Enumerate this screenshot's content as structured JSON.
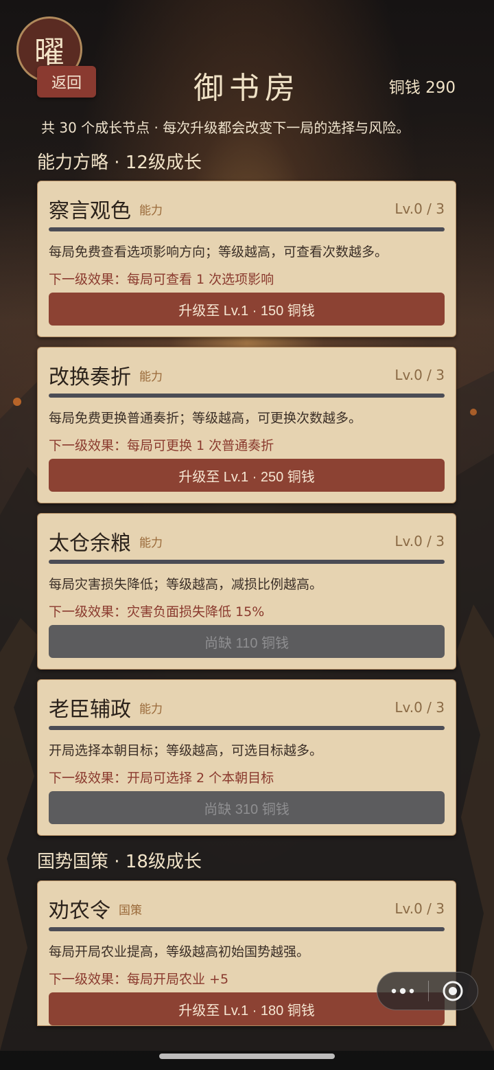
{
  "header": {
    "avatar_char": "曜",
    "back_label": "返回",
    "title": "御书房",
    "coins": "铜钱 290"
  },
  "subtitle": "共 30 个成长节点 · 每次升级都会改变下一局的选择与风险。",
  "sections": [
    {
      "title": "能力方略 · 12级成长",
      "cards": [
        {
          "name": "察言观色",
          "tag": "能力",
          "level": "Lv.0 / 3",
          "progress": 0,
          "desc": "每局免费查看选项影响方向；等级越高，可查看次数越多。",
          "next": "下一级效果：每局可查看 1 次选项影响",
          "action": "升级至 Lv.1 · 150 铜钱",
          "action_state": "buy"
        },
        {
          "name": "改换奏折",
          "tag": "能力",
          "level": "Lv.0 / 3",
          "progress": 0,
          "desc": "每局免费更换普通奏折；等级越高，可更换次数越多。",
          "next": "下一级效果：每局可更换 1 次普通奏折",
          "action": "升级至 Lv.1 · 250 铜钱",
          "action_state": "buy"
        },
        {
          "name": "太仓余粮",
          "tag": "能力",
          "level": "Lv.0 / 3",
          "progress": 0,
          "desc": "每局灾害损失降低；等级越高，减损比例越高。",
          "next": "下一级效果：灾害负面损失降低 15%",
          "action": "尚缺 110 铜钱",
          "action_state": "locked"
        },
        {
          "name": "老臣辅政",
          "tag": "能力",
          "level": "Lv.0 / 3",
          "progress": 0,
          "desc": "开局选择本朝目标；等级越高，可选目标越多。",
          "next": "下一级效果：开局可选择 2 个本朝目标",
          "action": "尚缺 310 铜钱",
          "action_state": "locked"
        }
      ]
    },
    {
      "title": "国势国策 · 18级成长",
      "cards": [
        {
          "name": "劝农令",
          "tag": "国策",
          "level": "Lv.0 / 3",
          "progress": 0,
          "desc": "每局开局农业提高，等级越高初始国势越强。",
          "next": "下一级效果：每局开局农业 +5",
          "action": "升级至 Lv.1 · 180 铜钱",
          "action_state": "buy"
        }
      ]
    }
  ],
  "colors": {
    "card_bg": "#e6d3b1",
    "buy_button": "#8c4233",
    "locked_button": "#5c5c5e",
    "accent_red": "#8a3a2e"
  },
  "icons": {
    "more": "more-dots-icon",
    "close": "target-circle-icon"
  }
}
